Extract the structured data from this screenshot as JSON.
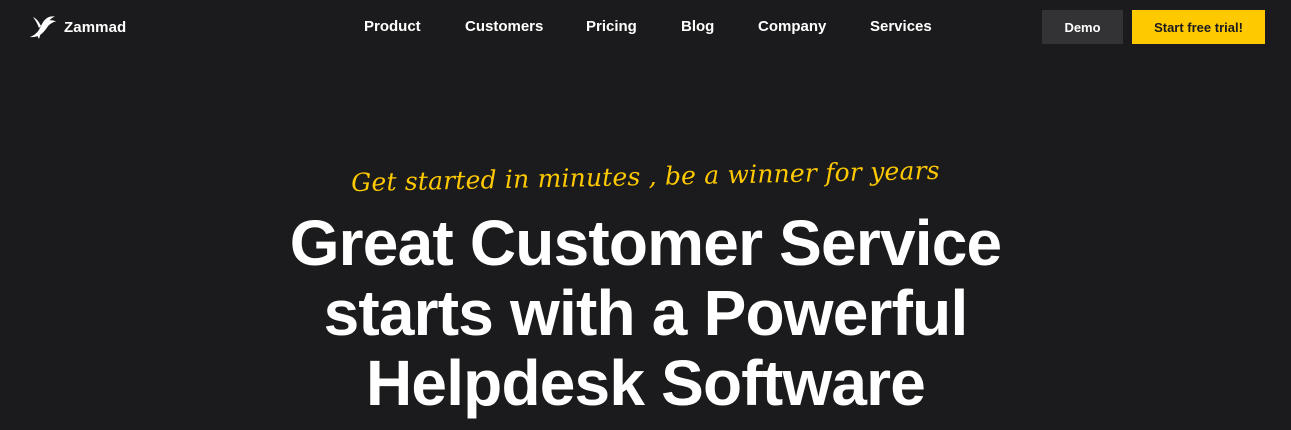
{
  "header": {
    "logo_text": "Zammad",
    "logo_icon": "bird-icon",
    "nav": [
      {
        "label": "Product"
      },
      {
        "label": "Customers"
      },
      {
        "label": "Pricing"
      },
      {
        "label": "Blog"
      },
      {
        "label": "Company"
      },
      {
        "label": "Services"
      }
    ],
    "demo_label": "Demo",
    "trial_label": "Start free trial!"
  },
  "hero": {
    "tagline": "Get started in minutes , be a winner for years",
    "headline_lines": [
      "Great Customer Service",
      "starts with a Powerful",
      "Helpdesk Software"
    ]
  },
  "colors": {
    "background": "#1b1b1d",
    "accent": "#ffc900",
    "demo_button": "#333336",
    "text": "#ffffff"
  }
}
